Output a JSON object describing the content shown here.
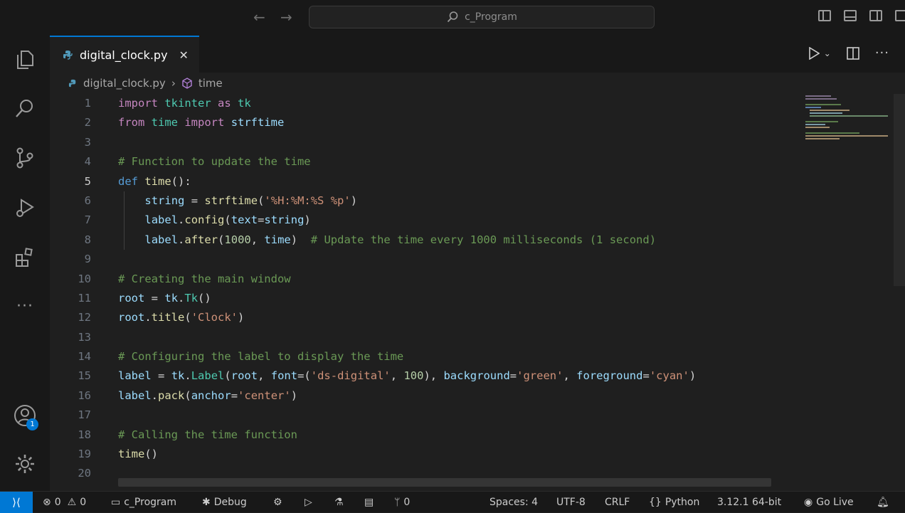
{
  "search": {
    "label": "c_Program"
  },
  "tab": {
    "name": "digital_clock.py",
    "close": "✕"
  },
  "breadcrumb": {
    "file": "digital_clock.py",
    "sep": "›",
    "symbol": "time"
  },
  "code_lines": [
    {
      "n": "1",
      "text": "import tkinter as tk"
    },
    {
      "n": "2",
      "text": "from time import strftime"
    },
    {
      "n": "3",
      "text": ""
    },
    {
      "n": "4",
      "text": "# Function to update the time"
    },
    {
      "n": "5",
      "text": "def time():"
    },
    {
      "n": "6",
      "text": "    string = strftime('%H:%M:%S %p')"
    },
    {
      "n": "7",
      "text": "    label.config(text=string)"
    },
    {
      "n": "8",
      "text": "    label.after(1000, time)  # Update the time every 1000 milliseconds (1 second)"
    },
    {
      "n": "9",
      "text": ""
    },
    {
      "n": "10",
      "text": "# Creating the main window"
    },
    {
      "n": "11",
      "text": "root = tk.Tk()"
    },
    {
      "n": "12",
      "text": "root.title('Clock')"
    },
    {
      "n": "13",
      "text": ""
    },
    {
      "n": "14",
      "text": "# Configuring the label to display the time"
    },
    {
      "n": "15",
      "text": "label = tk.Label(root, font=('ds-digital', 100), background='green', foreground='cyan')"
    },
    {
      "n": "16",
      "text": "label.pack(anchor='center')"
    },
    {
      "n": "17",
      "text": ""
    },
    {
      "n": "18",
      "text": "# Calling the time function"
    },
    {
      "n": "19",
      "text": "time()"
    },
    {
      "n": "20",
      "text": ""
    }
  ],
  "account_badge": "1",
  "status": {
    "errors": "0",
    "warnings": "0",
    "folder": "c_Program",
    "debug": "Debug",
    "ports": "0",
    "spaces": "Spaces: 4",
    "encoding": "UTF-8",
    "eol": "CRLF",
    "language": "Python",
    "interpreter": "3.12.1 64-bit",
    "golive": "Go Live"
  },
  "colors": {
    "accent": "#0078d4",
    "editor_bg": "#1f1f1f",
    "chrome_bg": "#181818"
  }
}
